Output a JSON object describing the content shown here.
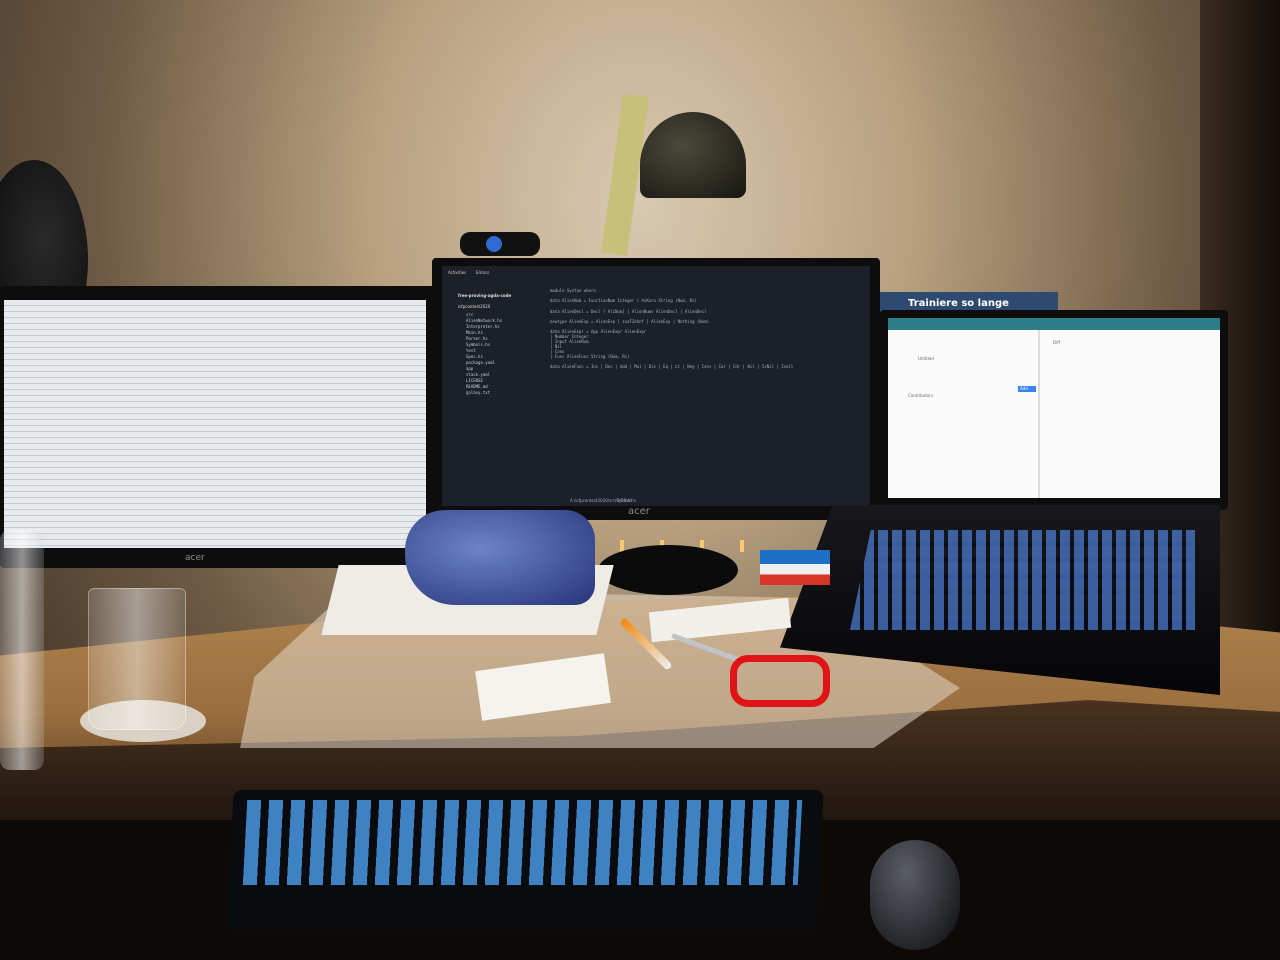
{
  "scene": {
    "description_elements": [
      "desk",
      "monitors",
      "laptop",
      "keyboard",
      "lamp"
    ]
  },
  "center_monitor": {
    "brand": "acer",
    "editor": {
      "topbar_left": "Activities",
      "topbar_app": "Emacs",
      "project_name": "free-proving-agda-code",
      "folder": "icfpcontest2020",
      "files": [
        "src",
        "AlienNetwork.hs",
        "Interpreter.hs",
        "Main.hs",
        "Parser.hs",
        "Symbols.hs",
        "test",
        "Spec.hs",
        "package.yaml",
        "app",
        "stack.yaml",
        "LICENSE",
        "README.md",
        "galaxy.txt"
      ],
      "code_lines": [
        "module Syntax where",
        "data AlienNum = FunctionNum Integer | AsKorn String (Num, Rs)",
        "data AlienDecl = Decl [ AliNum] | AlienNums AlienDecl | AlienDecl",
        "newtype AlienExp = AlienExp [ zuzFZehnf ] AlienExp | Nothing (Num)",
        "data AlienExpr = App AlienExpr AlienExpr",
        "              | Number Integer",
        "              | Input AlienNum",
        "              | Nil",
        "              | Cons",
        "              | Func AlienFunc String (Num, Rs)",
        "data AlienFunc = Inc | Dec | Add | Mul | Div | Eq | Lt | Neg | Cons | Car | Cdr | Nil | IsNil | Isnil"
      ],
      "status_path": "A /icfpcontest2020/src/Syntax.hs",
      "status_pos": "9:59  All"
    }
  },
  "left_monitor": {
    "brand": "acer"
  },
  "poster": {
    "text": "Trainiere so lange"
  },
  "laptop": {
    "left_pane_texts": [
      "Untitled",
      "Contributors",
      "Add"
    ],
    "right_pane_texts": [
      "Diff"
    ]
  }
}
